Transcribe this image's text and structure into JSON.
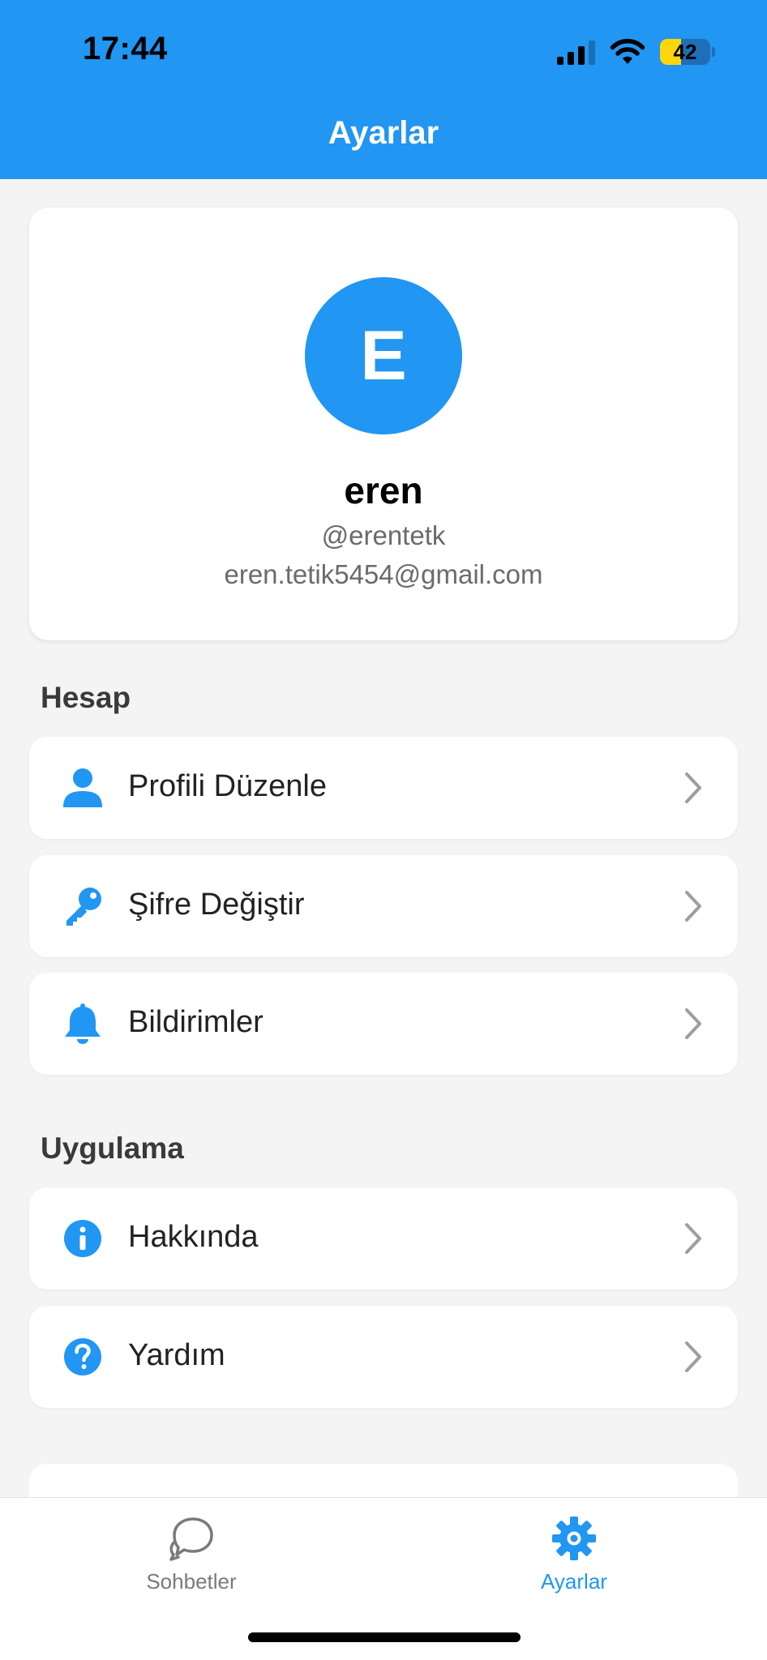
{
  "status_bar": {
    "time": "17:44",
    "battery": "42",
    "battery_level": 0.42
  },
  "header": {
    "title": "Ayarlar"
  },
  "profile": {
    "avatar_letter": "E",
    "name": "eren",
    "username": "@erentetk",
    "email": "eren.tetik5454@gmail.com"
  },
  "sections": {
    "account": {
      "title": "Hesap",
      "items": [
        {
          "label": "Profili Düzenle",
          "icon": "person-icon"
        },
        {
          "label": "Şifre Değiştir",
          "icon": "key-icon"
        },
        {
          "label": "Bildirimler",
          "icon": "bell-icon"
        }
      ]
    },
    "app": {
      "title": "Uygulama",
      "items": [
        {
          "label": "Hakkında",
          "icon": "info-icon"
        },
        {
          "label": "Yardım",
          "icon": "help-icon"
        }
      ]
    }
  },
  "tabbar": {
    "tabs": [
      {
        "label": "Sohbetler",
        "icon": "chat-bubble-icon",
        "active": false
      },
      {
        "label": "Ayarlar",
        "icon": "gear-icon",
        "active": true
      }
    ]
  },
  "colors": {
    "accent": "#2196f3",
    "background": "#f4f4f4",
    "card": "#ffffff",
    "chevron": "#9e9e9e"
  }
}
